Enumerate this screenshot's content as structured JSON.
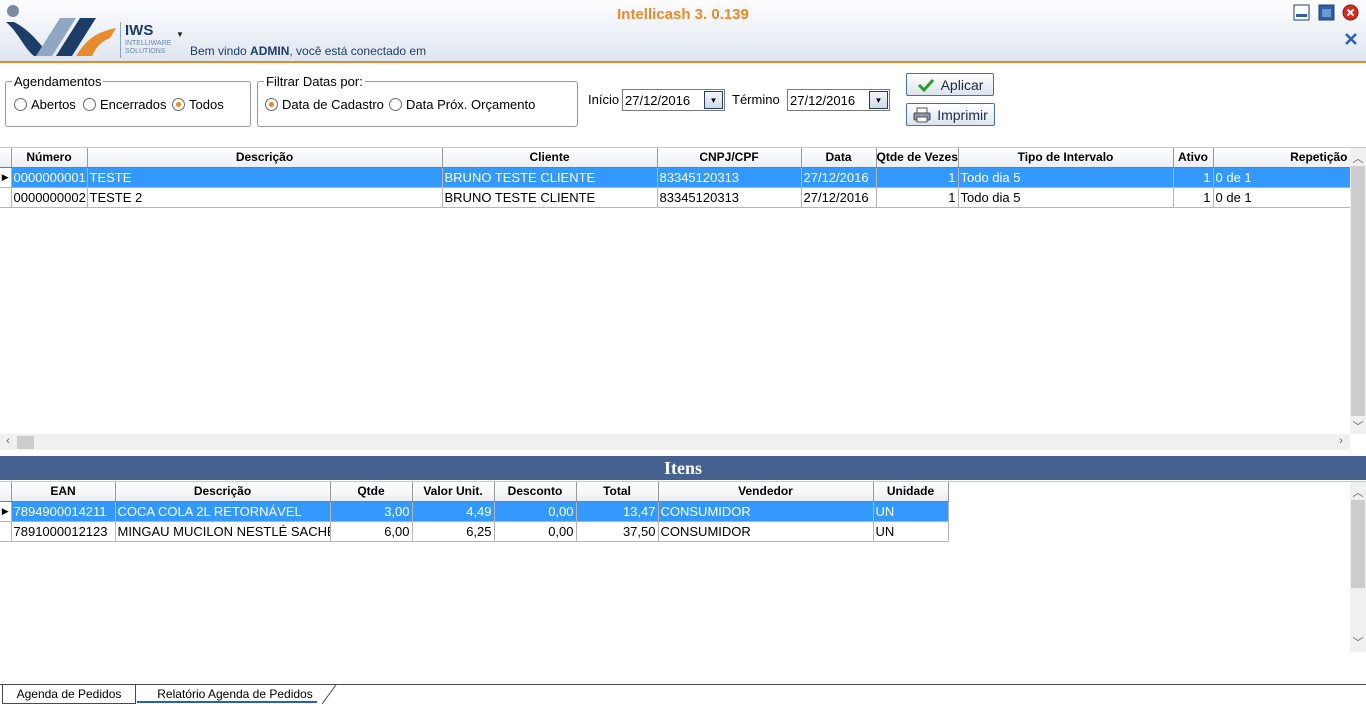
{
  "window": {
    "title": "Intellicash 3. 0.139",
    "welcome_prefix": "Bem vindo ",
    "welcome_user": "ADMIN",
    "welcome_suffix": ", você está conectado em",
    "logo_text": "IWS",
    "logo_subtext": "INTELLIWARE SOLUTIONS"
  },
  "filters": {
    "agendamentos": {
      "legend": "Agendamentos",
      "options": [
        "Abertos",
        "Encerrados",
        "Todos"
      ],
      "selected": "Todos"
    },
    "filtrar_datas": {
      "legend": "Filtrar Datas por:",
      "options": [
        "Data de Cadastro",
        "Data Próx. Orçamento"
      ],
      "selected": "Data de Cadastro"
    },
    "inicio_label": "Início",
    "inicio_value": "27/12/2016",
    "termino_label": "Término",
    "termino_value": "27/12/2016",
    "apply_label": "Aplicar",
    "print_label": "Imprimir"
  },
  "agenda_grid": {
    "columns": [
      "Número",
      "Descrição",
      "Cliente",
      "CNPJ/CPF",
      "Data",
      "Qtde de Vezes",
      "Tipo de Intervalo",
      "Ativo",
      "Repetição"
    ],
    "rows": [
      {
        "numero": "0000000001",
        "descricao": "TESTE",
        "cliente": "BRUNO TESTE CLIENTE",
        "cnpj": "83345120313",
        "data": "27/12/2016",
        "qtde": "1",
        "tipo": "Todo dia 5",
        "ativo": "1",
        "repeticao": "0 de 1"
      },
      {
        "numero": "0000000002",
        "descricao": "TESTE 2",
        "cliente": "BRUNO TESTE CLIENTE",
        "cnpj": "83345120313",
        "data": "27/12/2016",
        "qtde": "1",
        "tipo": "Todo dia 5",
        "ativo": "1",
        "repeticao": "0 de 1"
      }
    ],
    "selected_row": 0
  },
  "itens": {
    "title": "Itens",
    "columns": [
      "EAN",
      "Descrição",
      "Qtde",
      "Valor Unit.",
      "Desconto",
      "Total",
      "Vendedor",
      "Unidade"
    ],
    "rows": [
      {
        "ean": "7894900014211",
        "descricao": "COCA COLA 2L RETORNÁVEL",
        "qtde": "3,00",
        "valor": "4,49",
        "desconto": "0,00",
        "total": "13,47",
        "vendedor": "CONSUMIDOR",
        "unidade": "UN"
      },
      {
        "ean": "7891000012123",
        "descricao": "MINGAU MUCILON NESTLÉ SACHÊ",
        "qtde": "6,00",
        "valor": "6,25",
        "desconto": "0,00",
        "total": "37,50",
        "vendedor": "CONSUMIDOR",
        "unidade": "UN"
      }
    ],
    "selected_row": 0
  },
  "tabs": [
    {
      "label": "Agenda de Pedidos",
      "active": false
    },
    {
      "label": "Relatório Agenda de Pedidos",
      "active": true
    }
  ],
  "colors": {
    "accent_orange": "#e8892c",
    "selection_blue": "#3399ff",
    "header_bar": "#44618f",
    "brand_navy": "#1e3d66"
  }
}
